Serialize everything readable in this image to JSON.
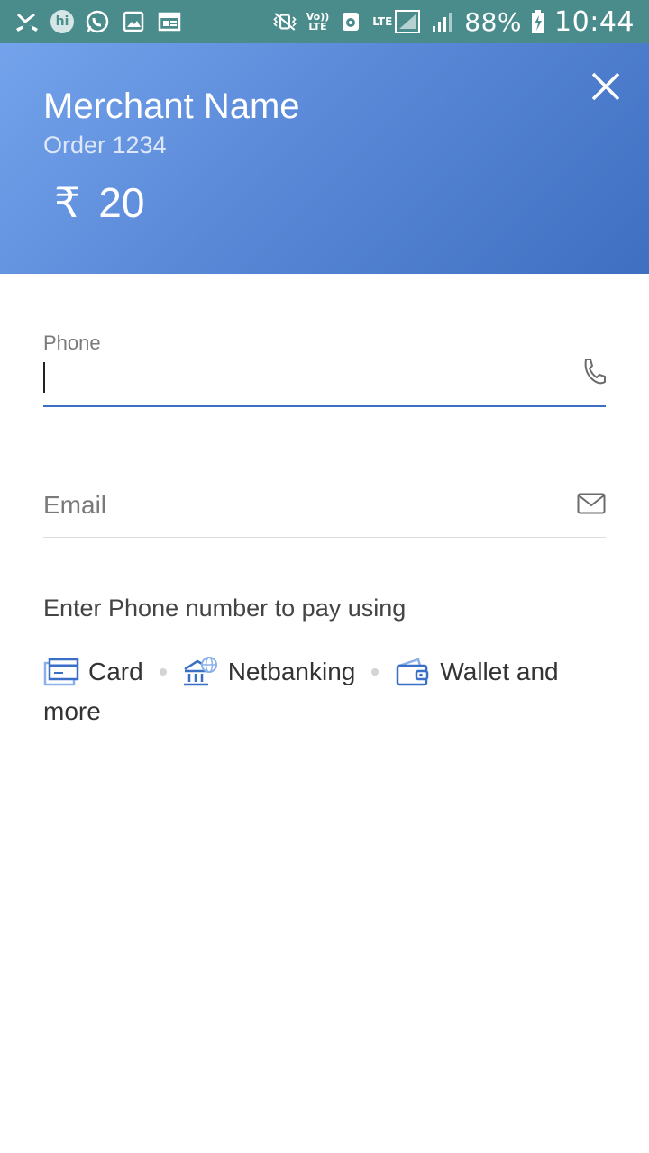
{
  "status_bar": {
    "hi_badge": "hi",
    "volte_top": "Vo))",
    "volte_bottom": "LTE",
    "lte": "LTE",
    "battery": "88%",
    "time": "10:44"
  },
  "header": {
    "merchant_name": "Merchant Name",
    "order": "Order 1234",
    "currency_symbol": "₹",
    "amount": "20"
  },
  "form": {
    "phone_label": "Phone",
    "phone_value": "",
    "email_label": "Email"
  },
  "hint": "Enter Phone number to pay using",
  "methods": {
    "card": "Card",
    "netbanking": "Netbanking",
    "wallet": "Wallet and",
    "more": "more"
  },
  "colors": {
    "header_start": "#74a3ec",
    "header_end": "#3f6fc1",
    "accent": "#3a6fc8",
    "status_bar": "#4a8c8c"
  }
}
